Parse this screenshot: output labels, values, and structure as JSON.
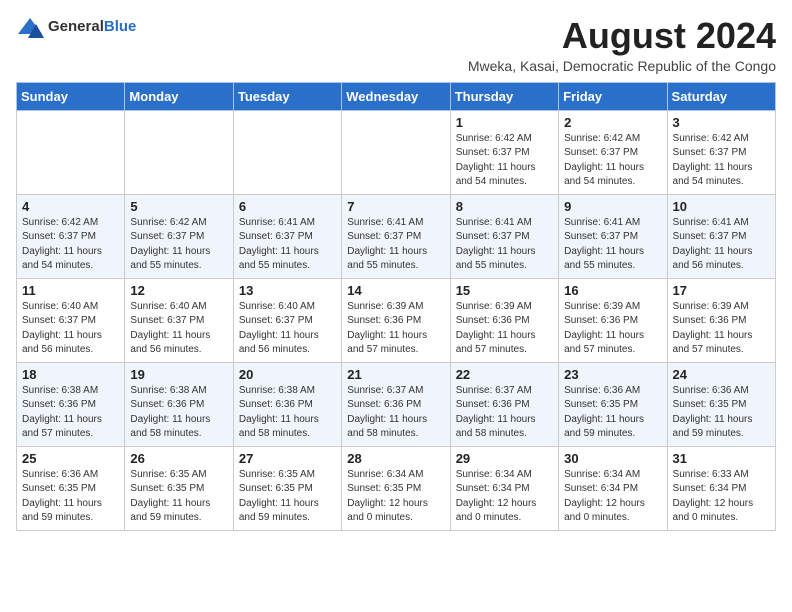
{
  "header": {
    "logo_general": "General",
    "logo_blue": "Blue",
    "month_title": "August 2024",
    "location": "Mweka, Kasai, Democratic Republic of the Congo"
  },
  "weekdays": [
    "Sunday",
    "Monday",
    "Tuesday",
    "Wednesday",
    "Thursday",
    "Friday",
    "Saturday"
  ],
  "weeks": [
    [
      {
        "day": "",
        "info": ""
      },
      {
        "day": "",
        "info": ""
      },
      {
        "day": "",
        "info": ""
      },
      {
        "day": "",
        "info": ""
      },
      {
        "day": "1",
        "info": "Sunrise: 6:42 AM\nSunset: 6:37 PM\nDaylight: 11 hours\nand 54 minutes."
      },
      {
        "day": "2",
        "info": "Sunrise: 6:42 AM\nSunset: 6:37 PM\nDaylight: 11 hours\nand 54 minutes."
      },
      {
        "day": "3",
        "info": "Sunrise: 6:42 AM\nSunset: 6:37 PM\nDaylight: 11 hours\nand 54 minutes."
      }
    ],
    [
      {
        "day": "4",
        "info": "Sunrise: 6:42 AM\nSunset: 6:37 PM\nDaylight: 11 hours\nand 54 minutes."
      },
      {
        "day": "5",
        "info": "Sunrise: 6:42 AM\nSunset: 6:37 PM\nDaylight: 11 hours\nand 55 minutes."
      },
      {
        "day": "6",
        "info": "Sunrise: 6:41 AM\nSunset: 6:37 PM\nDaylight: 11 hours\nand 55 minutes."
      },
      {
        "day": "7",
        "info": "Sunrise: 6:41 AM\nSunset: 6:37 PM\nDaylight: 11 hours\nand 55 minutes."
      },
      {
        "day": "8",
        "info": "Sunrise: 6:41 AM\nSunset: 6:37 PM\nDaylight: 11 hours\nand 55 minutes."
      },
      {
        "day": "9",
        "info": "Sunrise: 6:41 AM\nSunset: 6:37 PM\nDaylight: 11 hours\nand 55 minutes."
      },
      {
        "day": "10",
        "info": "Sunrise: 6:41 AM\nSunset: 6:37 PM\nDaylight: 11 hours\nand 56 minutes."
      }
    ],
    [
      {
        "day": "11",
        "info": "Sunrise: 6:40 AM\nSunset: 6:37 PM\nDaylight: 11 hours\nand 56 minutes."
      },
      {
        "day": "12",
        "info": "Sunrise: 6:40 AM\nSunset: 6:37 PM\nDaylight: 11 hours\nand 56 minutes."
      },
      {
        "day": "13",
        "info": "Sunrise: 6:40 AM\nSunset: 6:37 PM\nDaylight: 11 hours\nand 56 minutes."
      },
      {
        "day": "14",
        "info": "Sunrise: 6:39 AM\nSunset: 6:36 PM\nDaylight: 11 hours\nand 57 minutes."
      },
      {
        "day": "15",
        "info": "Sunrise: 6:39 AM\nSunset: 6:36 PM\nDaylight: 11 hours\nand 57 minutes."
      },
      {
        "day": "16",
        "info": "Sunrise: 6:39 AM\nSunset: 6:36 PM\nDaylight: 11 hours\nand 57 minutes."
      },
      {
        "day": "17",
        "info": "Sunrise: 6:39 AM\nSunset: 6:36 PM\nDaylight: 11 hours\nand 57 minutes."
      }
    ],
    [
      {
        "day": "18",
        "info": "Sunrise: 6:38 AM\nSunset: 6:36 PM\nDaylight: 11 hours\nand 57 minutes."
      },
      {
        "day": "19",
        "info": "Sunrise: 6:38 AM\nSunset: 6:36 PM\nDaylight: 11 hours\nand 58 minutes."
      },
      {
        "day": "20",
        "info": "Sunrise: 6:38 AM\nSunset: 6:36 PM\nDaylight: 11 hours\nand 58 minutes."
      },
      {
        "day": "21",
        "info": "Sunrise: 6:37 AM\nSunset: 6:36 PM\nDaylight: 11 hours\nand 58 minutes."
      },
      {
        "day": "22",
        "info": "Sunrise: 6:37 AM\nSunset: 6:36 PM\nDaylight: 11 hours\nand 58 minutes."
      },
      {
        "day": "23",
        "info": "Sunrise: 6:36 AM\nSunset: 6:35 PM\nDaylight: 11 hours\nand 59 minutes."
      },
      {
        "day": "24",
        "info": "Sunrise: 6:36 AM\nSunset: 6:35 PM\nDaylight: 11 hours\nand 59 minutes."
      }
    ],
    [
      {
        "day": "25",
        "info": "Sunrise: 6:36 AM\nSunset: 6:35 PM\nDaylight: 11 hours\nand 59 minutes."
      },
      {
        "day": "26",
        "info": "Sunrise: 6:35 AM\nSunset: 6:35 PM\nDaylight: 11 hours\nand 59 minutes."
      },
      {
        "day": "27",
        "info": "Sunrise: 6:35 AM\nSunset: 6:35 PM\nDaylight: 11 hours\nand 59 minutes."
      },
      {
        "day": "28",
        "info": "Sunrise: 6:34 AM\nSunset: 6:35 PM\nDaylight: 12 hours\nand 0 minutes."
      },
      {
        "day": "29",
        "info": "Sunrise: 6:34 AM\nSunset: 6:34 PM\nDaylight: 12 hours\nand 0 minutes."
      },
      {
        "day": "30",
        "info": "Sunrise: 6:34 AM\nSunset: 6:34 PM\nDaylight: 12 hours\nand 0 minutes."
      },
      {
        "day": "31",
        "info": "Sunrise: 6:33 AM\nSunset: 6:34 PM\nDaylight: 12 hours\nand 0 minutes."
      }
    ]
  ]
}
